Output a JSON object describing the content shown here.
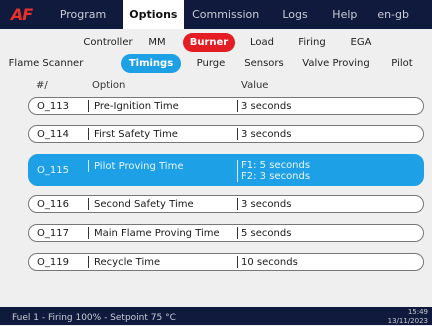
{
  "nav": {
    "logo": "AF",
    "items": [
      "Program",
      "Options",
      "Commission",
      "Logs",
      "Help",
      "en-gb"
    ],
    "active": "Options"
  },
  "subnav": {
    "row1": [
      "Controller",
      "MM",
      "Burner",
      "Load",
      "Firing",
      "EGA"
    ],
    "row1_selected": "Burner",
    "row2": [
      "Flame Scanner",
      "Timings",
      "Purge",
      "Sensors",
      "Valve Proving",
      "Pilot"
    ],
    "row2_selected": "Timings"
  },
  "table": {
    "headers": {
      "id": "#/",
      "option": "Option",
      "value": "Value"
    },
    "rows": [
      {
        "id": "O_113",
        "option": "Pre-Ignition Time",
        "value": "3 seconds"
      },
      {
        "id": "O_114",
        "option": "First Safety Time",
        "value": "3 seconds"
      },
      {
        "id": "O_115",
        "option": "Pilot Proving Time",
        "value_lines": [
          "F1: 5 seconds",
          "F2: 3 seconds"
        ]
      },
      {
        "id": "O_116",
        "option": "Second Safety Time",
        "value": "3 seconds"
      },
      {
        "id": "O_117",
        "option": "Main Flame Proving Time",
        "value": "5 seconds"
      },
      {
        "id": "O_119",
        "option": "Recycle Time",
        "value": "10 seconds"
      }
    ],
    "selected_id": "O_115"
  },
  "status": {
    "text": "Fuel 1 - Firing 100% - Setpoint 75 °C",
    "time": "15:49",
    "date": "13/11/2023"
  },
  "colors": {
    "nav_bg": "#101a3c",
    "accent_blue": "#1ea0e6",
    "accent_red": "#e31d23",
    "logo_red": "#e5302b"
  }
}
